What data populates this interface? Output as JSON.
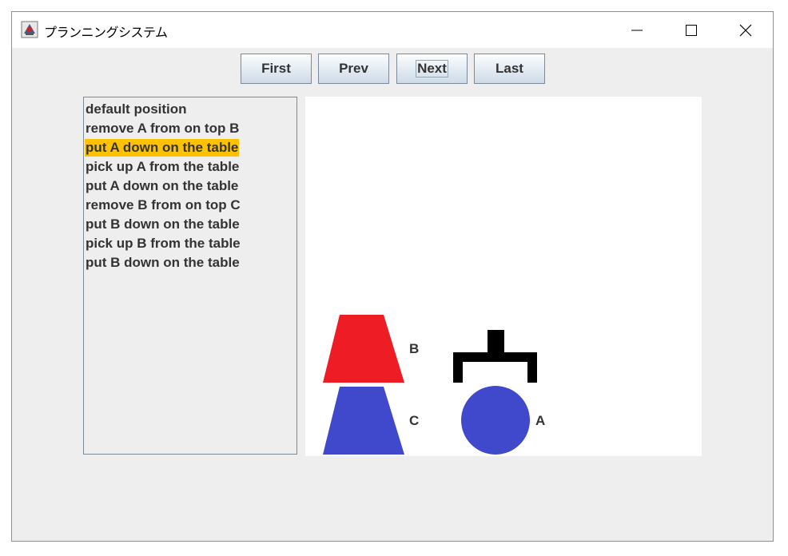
{
  "window": {
    "title": "プランニングシステム",
    "icon": "java-app-icon",
    "controls": [
      "minimize-icon",
      "maximize-icon",
      "close-icon"
    ]
  },
  "toolbar": {
    "first_label": "First",
    "prev_label": "Prev",
    "next_label": "Next",
    "last_label": "Last"
  },
  "steps": {
    "selected_index": 2,
    "items": [
      "default position",
      "remove A from on top B",
      "put A down on the table",
      "pick up A from the table",
      "put A down on the table",
      "remove B from on top C",
      "put B down on the table",
      "pick up B from the table",
      "put B down on the table"
    ]
  },
  "scene": {
    "colors": {
      "block_b": "#ee1c24",
      "block_c": "#4048cc",
      "block_a": "#4048cc",
      "gripper": "#000000",
      "highlight": "#ffc200"
    },
    "labels": {
      "block_b": "B",
      "block_c": "C",
      "block_a": "A"
    }
  }
}
